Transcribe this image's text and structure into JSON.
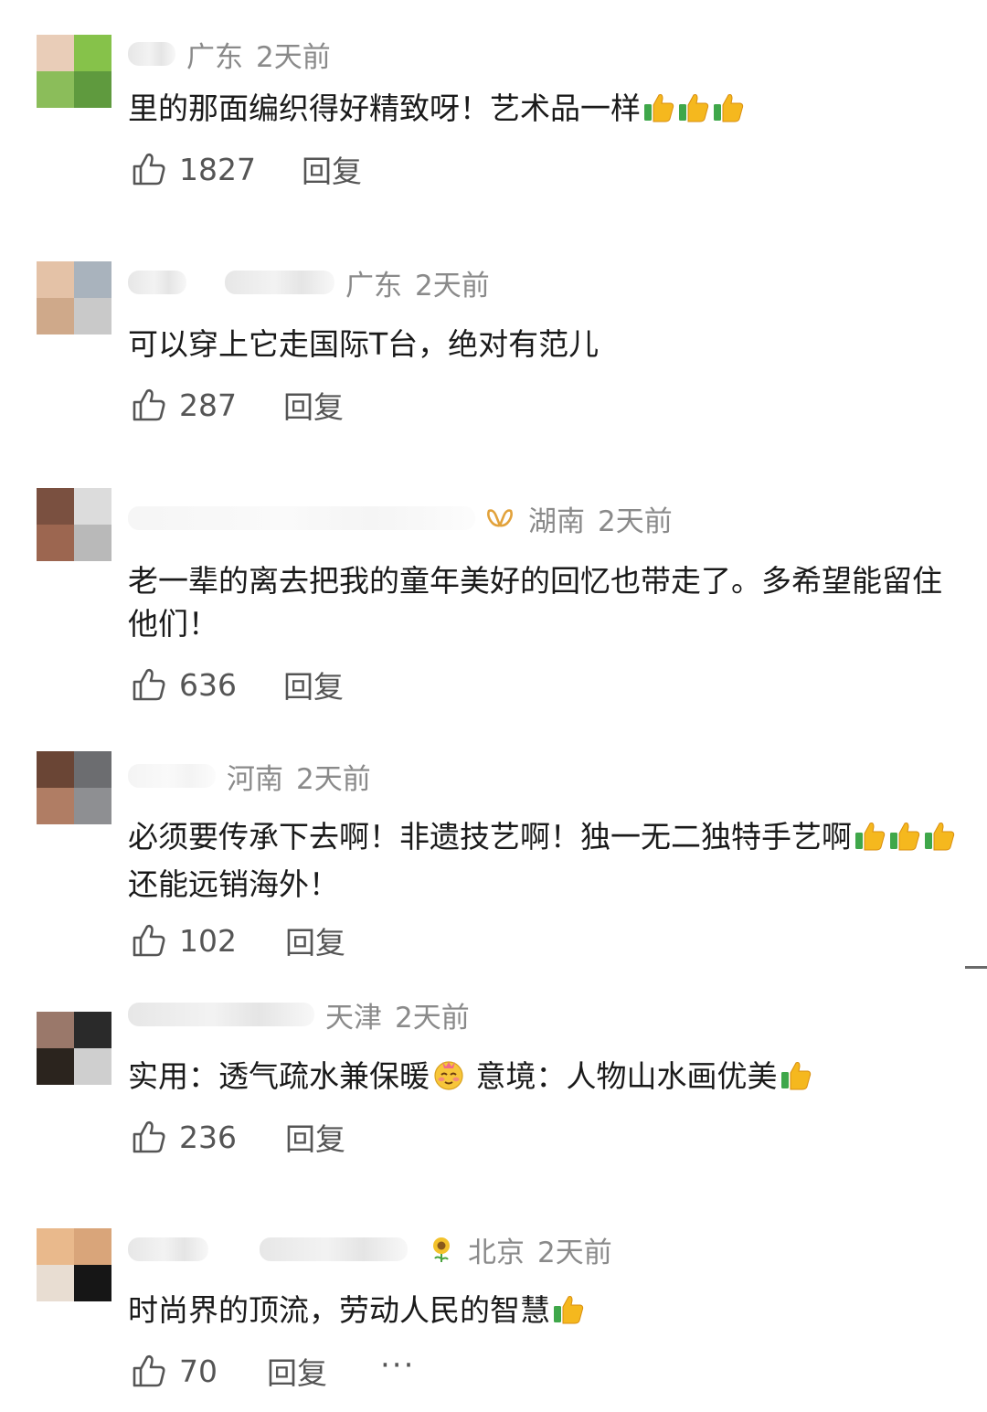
{
  "comments": [
    {
      "region": "广东",
      "time": "2天前",
      "text": "里的那面编织得好精致呀！艺术品一样",
      "emoji_count": 3,
      "likes": "1827",
      "reply": "回复",
      "avatar_colors": [
        "#e9cdb8",
        "#86c24a",
        "#8bbd5a",
        "#5f9a3e"
      ]
    },
    {
      "region": "广东",
      "time": "2天前",
      "text": "可以穿上它走国际T台，绝对有范儿",
      "likes": "287",
      "reply": "回复",
      "avatar_colors": [
        "#e4c2a7",
        "#a9b3bd",
        "#cfa98a",
        "#c9c9c9"
      ]
    },
    {
      "region": "湖南",
      "time": "2天前",
      "text": "老一辈的离去把我的童年美好的回忆也带走了。多希望能留住他们！",
      "likes": "636",
      "reply": "回复",
      "avatar_colors": [
        "#7a5040",
        "#dcdcdc",
        "#9c6650",
        "#b9b9b9"
      ]
    },
    {
      "region": "河南",
      "time": "2天前",
      "text": "必须要传承下去啊！非遗技艺啊！独一无二独特手艺啊",
      "text2": "还能远销海外！",
      "emoji_count": 3,
      "likes": "102",
      "reply": "回复",
      "avatar_colors": [
        "#6a4535",
        "#6c6d70",
        "#b07d64",
        "#8e8f92"
      ]
    },
    {
      "region": "天津",
      "time": "2天前",
      "text": "实用：透气疏水兼保暖",
      "text2": " 意境：人物山水画优美",
      "likes": "236",
      "reply": "回复",
      "avatar_colors": [
        "#9a786a",
        "#2a2a2a",
        "#2b241e",
        "#cfcfcf"
      ]
    },
    {
      "region": "北京",
      "time": "2天前",
      "text": "时尚界的顶流，劳动人民的智慧",
      "likes": "70",
      "reply": "回复",
      "more": "···",
      "avatar_colors": [
        "#e9b98c",
        "#d9a57a",
        "#e8ddd2",
        "#161616"
      ]
    }
  ]
}
